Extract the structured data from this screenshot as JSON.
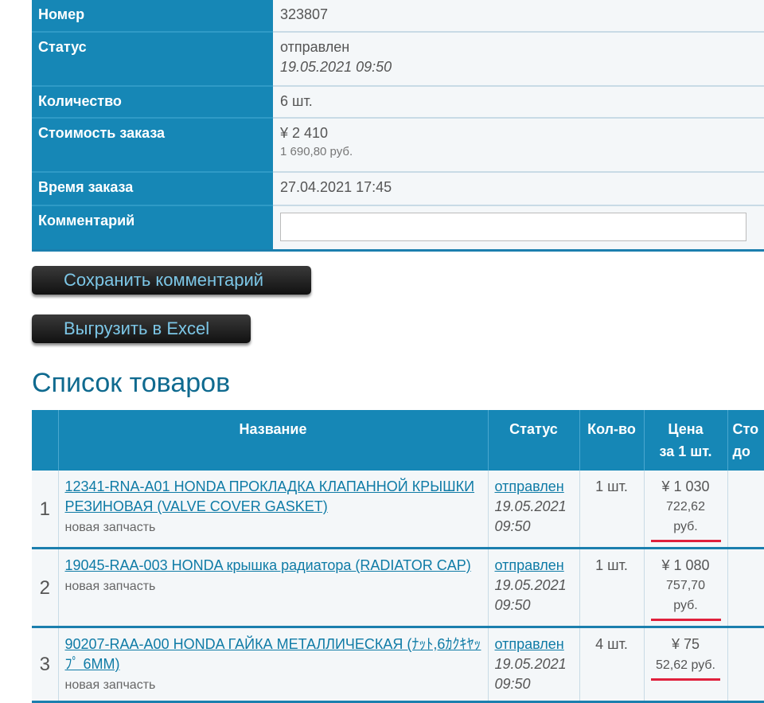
{
  "order": {
    "number_label": "Номер",
    "number_value": "323807",
    "status_label": "Статус",
    "status_value": "отправлен",
    "status_date": "19.05.2021 09:50",
    "qty_label": "Количество",
    "qty_value": "6 шт.",
    "cost_label": "Стоимость заказа",
    "cost_yen": "¥ 2 410",
    "cost_rub": "1 690,80 руб.",
    "time_label": "Время заказа",
    "time_value": "27.04.2021 17:45",
    "comment_label": "Комментарий",
    "comment_value": ""
  },
  "buttons": {
    "save_comment": "Сохранить комментарий",
    "export_excel": "Выгрузить в Excel"
  },
  "items_heading": "Список товаров",
  "table": {
    "headers": {
      "name": "Название",
      "status": "Статус",
      "qty": "Кол-во",
      "price_line1": "Цена",
      "price_line2": "за 1 шт.",
      "total_line1": "Сто",
      "total_line2": "до"
    },
    "rows": [
      {
        "num": "1",
        "name": "12341-RNA-A01 HONDA ПРОКЛАДКА КЛАПАННОЙ КРЫШКИ РЕЗИНОВАЯ (VALVE COVER GASKET)",
        "condition": "новая запчасть",
        "status": "отправлен",
        "date": "19.05.2021 09:50",
        "qty": "1 шт.",
        "price_yen": "¥ 1 030",
        "price_rub": "722,62 руб."
      },
      {
        "num": "2",
        "name": "19045-RAA-003 HONDA крышка радиатора (RADIATOR CAP)",
        "condition": "новая запчасть",
        "status": "отправлен",
        "date": "19.05.2021 09:50",
        "qty": "1 шт.",
        "price_yen": "¥ 1 080",
        "price_rub": "757,70 руб."
      },
      {
        "num": "3",
        "name": "90207-RAA-A00 HONDA ГАЙКА МЕТАЛЛИЧЕСКАЯ (ﾅｯﾄ,6ｶｸｷﾔｯﾌﾟ 6MM)",
        "condition": "новая запчасть",
        "status": "отправлен",
        "date": "19.05.2021 09:50",
        "qty": "4 шт.",
        "price_yen": "¥ 75",
        "price_rub": "52,62 руб."
      }
    ]
  },
  "colors": {
    "header_blue": "#1687b6",
    "link_blue": "#0f7ba6",
    "highlight_red": "#e0203c"
  }
}
